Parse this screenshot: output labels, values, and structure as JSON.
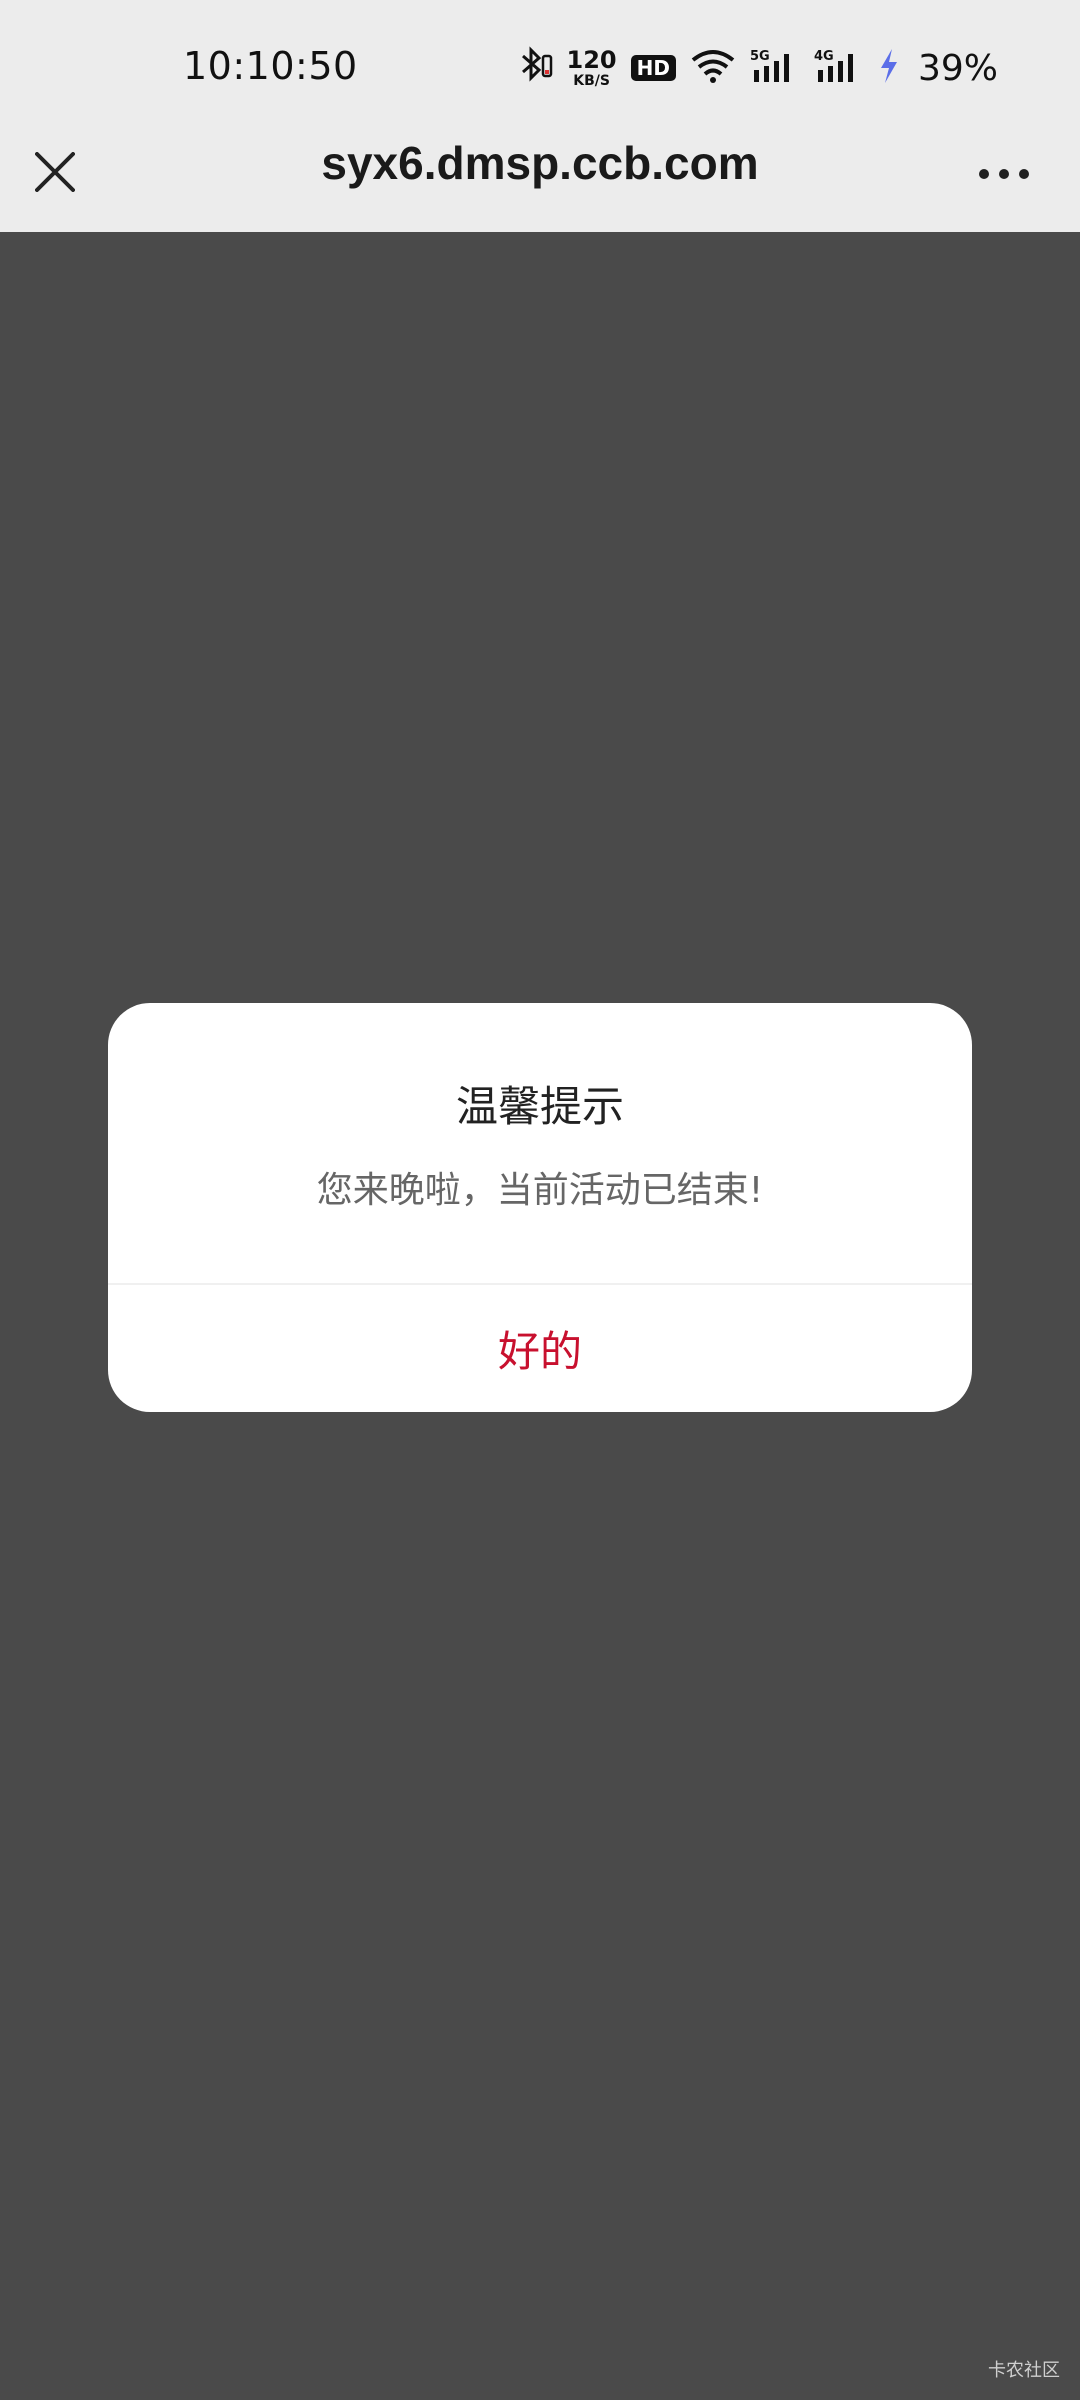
{
  "status_bar": {
    "time": "10:10:50",
    "speed_value": "120",
    "speed_unit": "KB/S",
    "hd_label": "HD",
    "signal_5g_label": "5G",
    "signal_4g_label": "4G",
    "battery": "39%",
    "charging_color": "#5b6ee8"
  },
  "nav": {
    "title": "syx6.dmsp.ccb.com",
    "close_icon": "close-icon",
    "more_icon": "more-icon"
  },
  "dialog": {
    "title": "温馨提示",
    "message": "您来晚啦，当前活动已结束!",
    "confirm_label": "好的",
    "confirm_color": "#c8102e"
  },
  "watermark": "卡农社区"
}
